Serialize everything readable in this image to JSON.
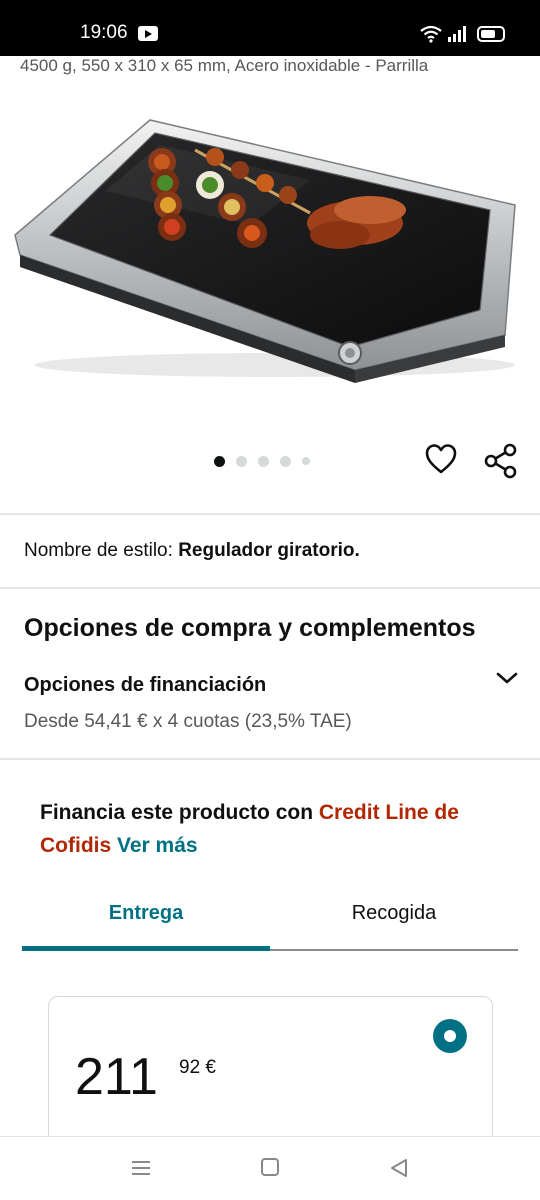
{
  "status_bar": {
    "time": "19:06"
  },
  "product": {
    "subtitle": "4500 g, 550 x 310 x 65 mm, Acero inoxidable - Parrilla",
    "image_icon": "electric-grill-plate-image",
    "carousel": {
      "total": 5,
      "active": 1
    }
  },
  "style": {
    "label": "Nombre de estilo:",
    "value": "Regulador giratorio."
  },
  "purchase": {
    "title": "Opciones de compra y complementos",
    "financing_title": "Opciones de financiación",
    "financing_desc": "Desde 54,41 € x 4 cuotas (23,5% TAE)"
  },
  "credit": {
    "prefix": "Financia este producto con ",
    "brand": "Credit Line de Cofidis",
    "link": "Ver más"
  },
  "tabs": [
    {
      "label": "Entrega",
      "active": true
    },
    {
      "label": "Recogida",
      "active": false
    }
  ],
  "price": {
    "whole": "211",
    "fraction": "92 €"
  },
  "icons": {
    "heart": "heart-icon",
    "share": "share-icon",
    "chevron": "chevron-down-icon"
  },
  "colors": {
    "link_teal": "#007185",
    "brand_red": "#b12704",
    "text_dark": "#0f1111",
    "text_muted": "#565959"
  }
}
